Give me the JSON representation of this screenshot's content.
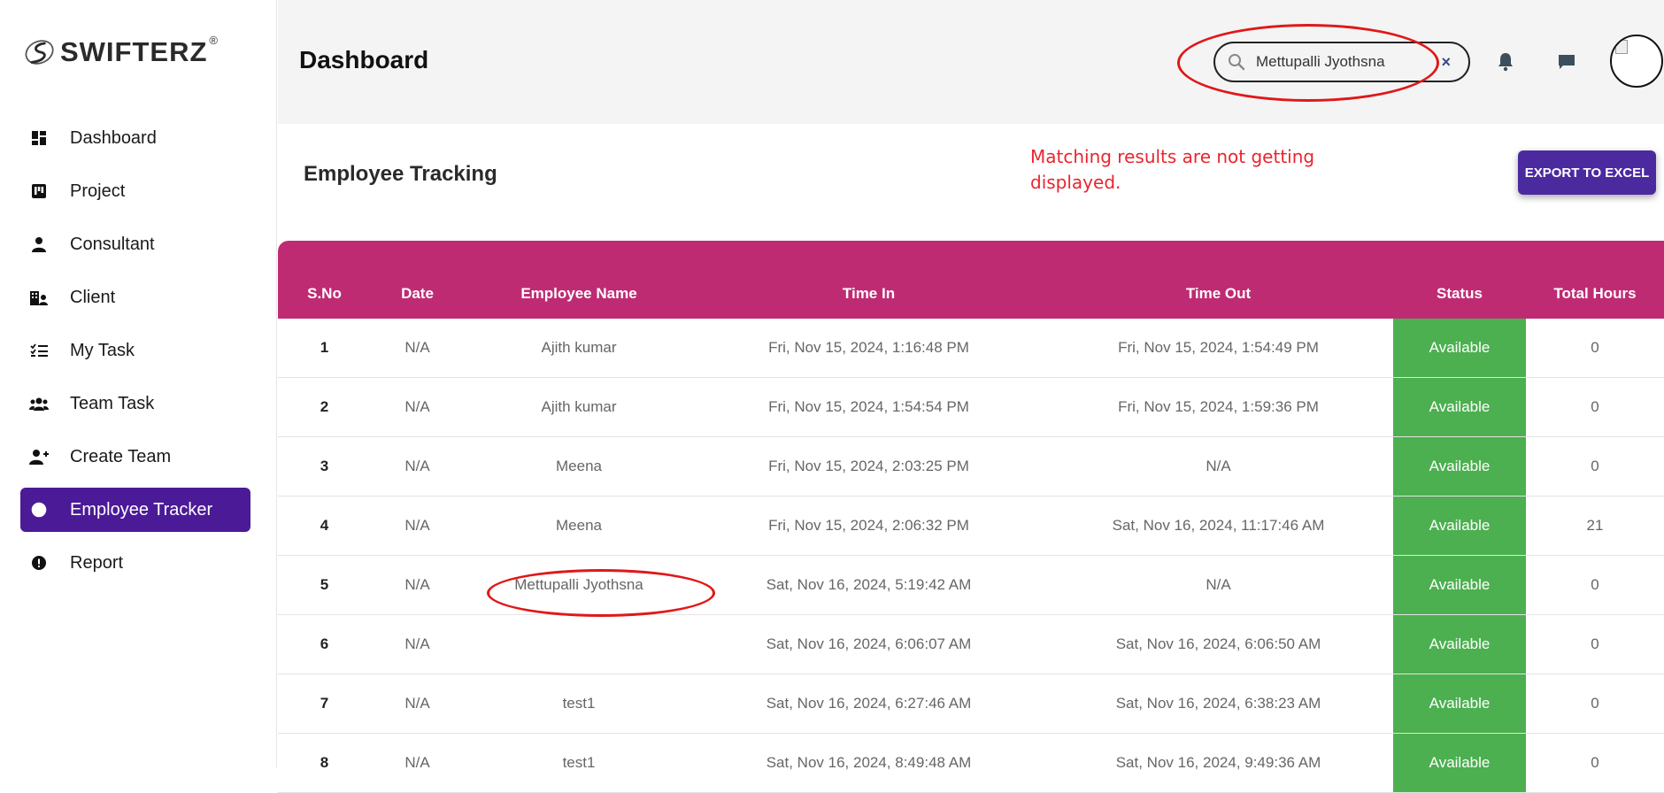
{
  "brand": {
    "name": "SWIFTERZ",
    "reg": "®"
  },
  "sidebar": {
    "items": [
      {
        "label": "Dashboard",
        "icon": "dashboard-icon"
      },
      {
        "label": "Project",
        "icon": "project-icon"
      },
      {
        "label": "Consultant",
        "icon": "person-icon"
      },
      {
        "label": "Client",
        "icon": "client-building-icon"
      },
      {
        "label": "My Task",
        "icon": "checklist-icon"
      },
      {
        "label": "Team Task",
        "icon": "group-icon"
      },
      {
        "label": "Create Team",
        "icon": "add-person-icon"
      },
      {
        "label": "Employee Tracker",
        "icon": "tracker-icon",
        "active": true
      },
      {
        "label": "Report",
        "icon": "alert-circle-icon"
      }
    ]
  },
  "header": {
    "title": "Dashboard",
    "search_value": "Mettupalli Jyothsna",
    "clear_symbol": "×"
  },
  "card": {
    "title": "Employee Tracking",
    "annotation": "Matching results are not getting displayed.",
    "export_label": "EXPORT TO EXCEL"
  },
  "table": {
    "columns": [
      "S.No",
      "Date",
      "Employee Name",
      "Time In",
      "Time Out",
      "Status",
      "Total Hours"
    ],
    "rows": [
      [
        "1",
        "N/A",
        "Ajith kumar",
        "Fri, Nov 15, 2024, 1:16:48 PM",
        "Fri, Nov 15, 2024, 1:54:49 PM",
        "Available",
        "0"
      ],
      [
        "2",
        "N/A",
        "Ajith kumar",
        "Fri, Nov 15, 2024, 1:54:54 PM",
        "Fri, Nov 15, 2024, 1:59:36 PM",
        "Available",
        "0"
      ],
      [
        "3",
        "N/A",
        "Meena",
        "Fri, Nov 15, 2024, 2:03:25 PM",
        "N/A",
        "Available",
        "0"
      ],
      [
        "4",
        "N/A",
        "Meena",
        "Fri, Nov 15, 2024, 2:06:32 PM",
        "Sat, Nov 16, 2024, 11:17:46 AM",
        "Available",
        "21"
      ],
      [
        "5",
        "N/A",
        "Mettupalli Jyothsna",
        "Sat, Nov 16, 2024, 5:19:42 AM",
        "N/A",
        "Available",
        "0"
      ],
      [
        "6",
        "N/A",
        "",
        "Sat, Nov 16, 2024, 6:06:07 AM",
        "Sat, Nov 16, 2024, 6:06:50 AM",
        "Available",
        "0"
      ],
      [
        "7",
        "N/A",
        "test1",
        "Sat, Nov 16, 2024, 6:27:46 AM",
        "Sat, Nov 16, 2024, 6:38:23 AM",
        "Available",
        "0"
      ],
      [
        "8",
        "N/A",
        "test1",
        "Sat, Nov 16, 2024, 8:49:48 AM",
        "Sat, Nov 16, 2024, 9:49:36 AM",
        "Available",
        "0"
      ]
    ]
  },
  "colors": {
    "accent": "#4b1a97",
    "table_header": "#bf2b73",
    "status_available": "#4caf50",
    "annotation": "#e01818"
  }
}
